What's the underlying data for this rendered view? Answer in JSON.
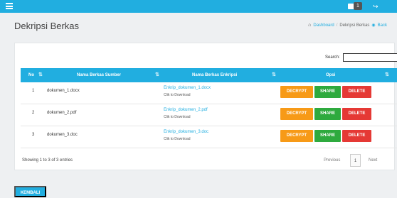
{
  "page": {
    "title": "Dekripsi Berkas"
  },
  "topbar": {
    "badge": "1"
  },
  "breadcrumb": {
    "home": "Dashboard",
    "current": "Dekripsi Berkas",
    "back": "Back"
  },
  "search": {
    "label": "Search:",
    "value": ""
  },
  "table": {
    "columns": [
      "No",
      "Nama Berkas Sumber",
      "Nama Berkas Enkripsi",
      "Opsi"
    ],
    "rows": [
      {
        "no": "1",
        "source": "dokumen_1.docx",
        "encrypted": "Enkrip_dokumen_1.docx",
        "download": "Clik to Download"
      },
      {
        "no": "2",
        "source": "dokumen_2.pdf",
        "encrypted": "Enkrip_dokumen_2.pdf",
        "download": "Clik to Download"
      },
      {
        "no": "3",
        "source": "dokumen_3.doc",
        "encrypted": "Enkrip_dokumen_3.doc",
        "download": "Clik to Download"
      }
    ],
    "actions": {
      "decrypt": "DECRYPT",
      "share": "SHARE",
      "delete": "DELETE"
    }
  },
  "footer": {
    "info": "Showing 1 to 3 of 3 entries",
    "prev": "Previous",
    "page": "1",
    "next": "Next"
  },
  "back_button": "KEMBALI",
  "colors": {
    "accent": "#21aee0",
    "decrypt": "#f79a17",
    "share": "#2eaa3e",
    "delete": "#e53935"
  },
  "icons": [
    "menu-icon",
    "mail-icon",
    "logout-icon",
    "home-icon",
    "back-circle-icon",
    "sort-icon"
  ]
}
